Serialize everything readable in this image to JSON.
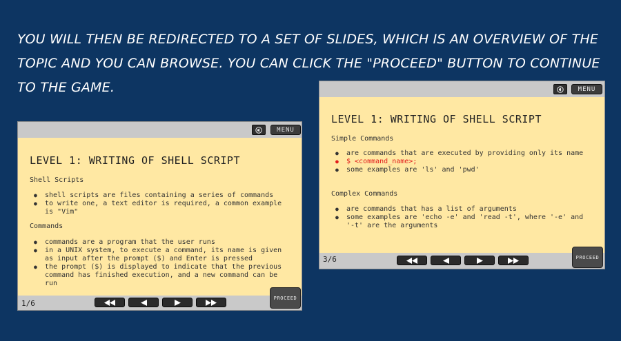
{
  "caption": "YOU WILL THEN BE REDIRECTED TO A SET OF SLIDES, WHICH IS AN OVERVIEW OF THE TOPIC AND YOU CAN BROWSE. YOU CAN CLICK THE \"PROCEED\" BUTTON TO CONTINUE TO THE GAME.",
  "slide1": {
    "menu_label": "MENU",
    "title": "LEVEL 1: WRITING OF SHELL SCRIPT",
    "section1_heading": "Shell Scripts",
    "section1_items": [
      "shell scripts are files containing a series of commands",
      "to write one, a text editor is required, a common example is \"Vim\""
    ],
    "section2_heading": "Commands",
    "section2_items": [
      "commands are a program that the user runs",
      "in a UNIX system, to execute a command, its name is given as input after the prompt ($) and Enter is pressed",
      "the prompt ($) is displayed to indicate that the previous command has finished execution, and a new command can be run"
    ],
    "page_counter": "1/6",
    "proceed_label": "PROCEED"
  },
  "slide2": {
    "menu_label": "MENU",
    "title": "LEVEL 1: WRITING OF SHELL SCRIPT",
    "section1_heading": "Simple Commands",
    "section1_items": [
      "are commands that are executed by providing only its name",
      "$ <command_name>;",
      "some examples are 'ls' and 'pwd'"
    ],
    "section2_heading": "Complex Commands",
    "section2_items": [
      "are commands that has a list of arguments",
      "some examples are 'echo -e' and 'read -t', where '-e' and '-t' are the arguments"
    ],
    "page_counter": "3/6",
    "proceed_label": "PROCEED"
  },
  "icons": {
    "sound": "speaker-icon",
    "first": "rewind-icon",
    "prev": "triangle-left-icon",
    "next": "triangle-right-icon",
    "last": "fast-forward-icon"
  },
  "colors": {
    "background": "#0d3562",
    "slide": "#ffe8a3",
    "highlight": "#e21b1b"
  }
}
